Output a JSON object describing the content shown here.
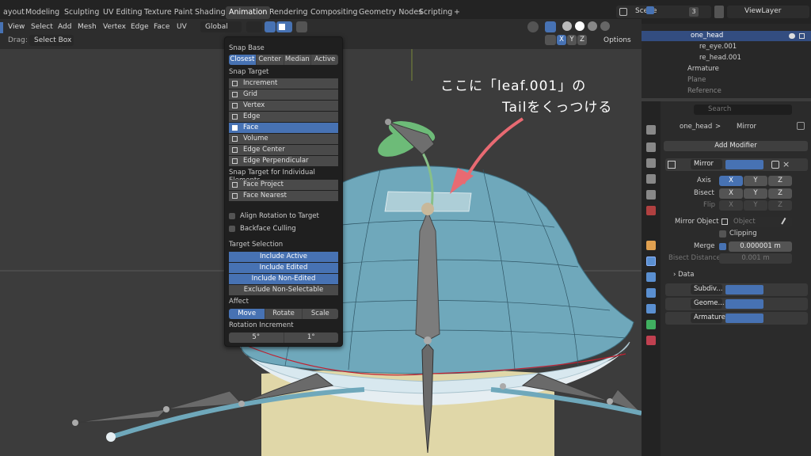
{
  "workspace_tabs": [
    "ayout",
    "Modeling",
    "Sculpting",
    "UV Editing",
    "Texture Paint",
    "Shading",
    "Animation",
    "Rendering",
    "Compositing",
    "Geometry Nodes",
    "Scripting",
    "+"
  ],
  "active_tab": "Animation",
  "scene": {
    "label": "Scene",
    "count": "3",
    "view_layer": "ViewLayer"
  },
  "header": {
    "menus": [
      "View",
      "Select",
      "Add",
      "Mesh",
      "Vertex",
      "Edge",
      "Face",
      "UV"
    ],
    "orientation": "Global",
    "drag_label": "Drag:",
    "drag_value": "Select Box",
    "axes": [
      "X",
      "Y",
      "Z"
    ],
    "options_label": "Options"
  },
  "snap": {
    "base_title": "Snap Base",
    "base_options": [
      "Closest",
      "Center",
      "Median",
      "Active"
    ],
    "target_title": "Snap Target",
    "targets": [
      "Increment",
      "Grid",
      "Vertex",
      "Edge",
      "Face",
      "Volume",
      "Edge Center",
      "Edge Perpendicular"
    ],
    "individual_title": "Snap Target for Individual Elements",
    "individual": [
      "Face Project",
      "Face Nearest"
    ],
    "align_rotation": "Align Rotation to Target",
    "backface": "Backface Culling",
    "selection_title": "Target Selection",
    "selection": [
      "Include Active",
      "Include Edited",
      "Include Non-Edited",
      "Exclude Non-Selectable"
    ],
    "affect_title": "Affect",
    "affect": [
      "Move",
      "Rotate",
      "Scale"
    ],
    "rotation_title": "Rotation Increment",
    "rotation": [
      "5°",
      "1°"
    ]
  },
  "annotation": {
    "line1": "ここに「leaf.001」の",
    "line2": "Tailをくっつける"
  },
  "outliner": {
    "search_placeholder": "Search",
    "rows": [
      "one_head",
      "re_eye.001",
      "re_head.001",
      "Armature",
      "Plane",
      "Reference"
    ]
  },
  "properties": {
    "search_placeholder": "Search",
    "breadcrumb_object": "one_head",
    "breadcrumb_sep": ">",
    "breadcrumb_modifier": "Mirror",
    "add_modifier": "Add Modifier",
    "mirror_name": "Mirror",
    "axis_label": "Axis",
    "bisect_label": "Bisect",
    "flip_label": "Flip",
    "xyz": [
      "X",
      "Y",
      "Z"
    ],
    "mirror_object_label": "Mirror Object",
    "mirror_object_placeholder": "Object",
    "clipping_label": "Clipping",
    "merge_label": "Merge",
    "merge_value": "0.000001 m",
    "bisect_distance_label": "Bisect Distance",
    "bisect_distance_value": "0.001 m",
    "data_label": "Data",
    "other_modifiers": [
      "Subdiv...",
      "Geome...",
      "Armature"
    ]
  },
  "colors": {
    "accent": "#4772b3",
    "mesh": "#6fa8bb",
    "leaf": "#6dbb78",
    "arrow": "#e86a72"
  }
}
